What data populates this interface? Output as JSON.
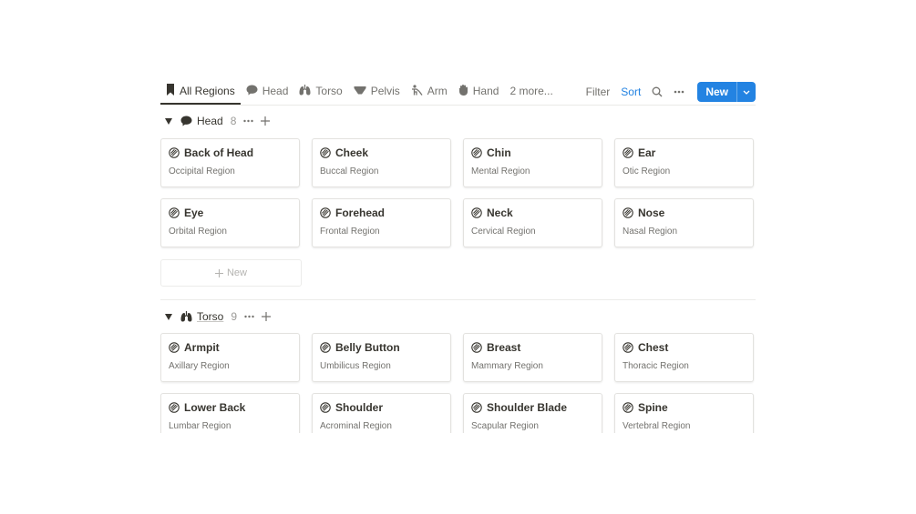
{
  "tabs": [
    {
      "label": "All Regions",
      "icon": "bookmark-icon"
    },
    {
      "label": "Head",
      "icon": "head-icon"
    },
    {
      "label": "Torso",
      "icon": "lungs-icon"
    },
    {
      "label": "Pelvis",
      "icon": "briefs-icon"
    },
    {
      "label": "Arm",
      "icon": "arm-icon"
    },
    {
      "label": "Hand",
      "icon": "hand-icon"
    },
    {
      "label": "2 more..."
    }
  ],
  "tools": {
    "filter": "Filter",
    "sort": "Sort",
    "new": "New"
  },
  "groups": [
    {
      "name": "Head",
      "count": "8",
      "icon": "head-icon",
      "cards": [
        {
          "title": "Back of Head",
          "subtitle": "Occipital Region"
        },
        {
          "title": "Cheek",
          "subtitle": "Buccal Region"
        },
        {
          "title": "Chin",
          "subtitle": "Mental Region"
        },
        {
          "title": "Ear",
          "subtitle": "Otic Region"
        },
        {
          "title": "Eye",
          "subtitle": "Orbital Region"
        },
        {
          "title": "Forehead",
          "subtitle": "Frontal Region"
        },
        {
          "title": "Neck",
          "subtitle": "Cervical Region"
        },
        {
          "title": "Nose",
          "subtitle": "Nasal Region"
        }
      ],
      "new_label": "New"
    },
    {
      "name": "Torso",
      "count": "9",
      "icon": "lungs-icon",
      "cards": [
        {
          "title": "Armpit",
          "subtitle": "Axillary Region"
        },
        {
          "title": "Belly Button",
          "subtitle": "Umbilicus Region"
        },
        {
          "title": "Breast",
          "subtitle": "Mammary Region"
        },
        {
          "title": "Chest",
          "subtitle": "Thoracic Region"
        },
        {
          "title": "Lower Back",
          "subtitle": "Lumbar Region"
        },
        {
          "title": "Shoulder",
          "subtitle": "Acrominal Region"
        },
        {
          "title": "Shoulder Blade",
          "subtitle": "Scapular Region"
        },
        {
          "title": "Spine",
          "subtitle": "Vertebral Region"
        }
      ]
    }
  ],
  "colors": {
    "accent": "#2383e2",
    "text": "#37352f",
    "muted": "#73726e",
    "border": "#e3e2df"
  }
}
